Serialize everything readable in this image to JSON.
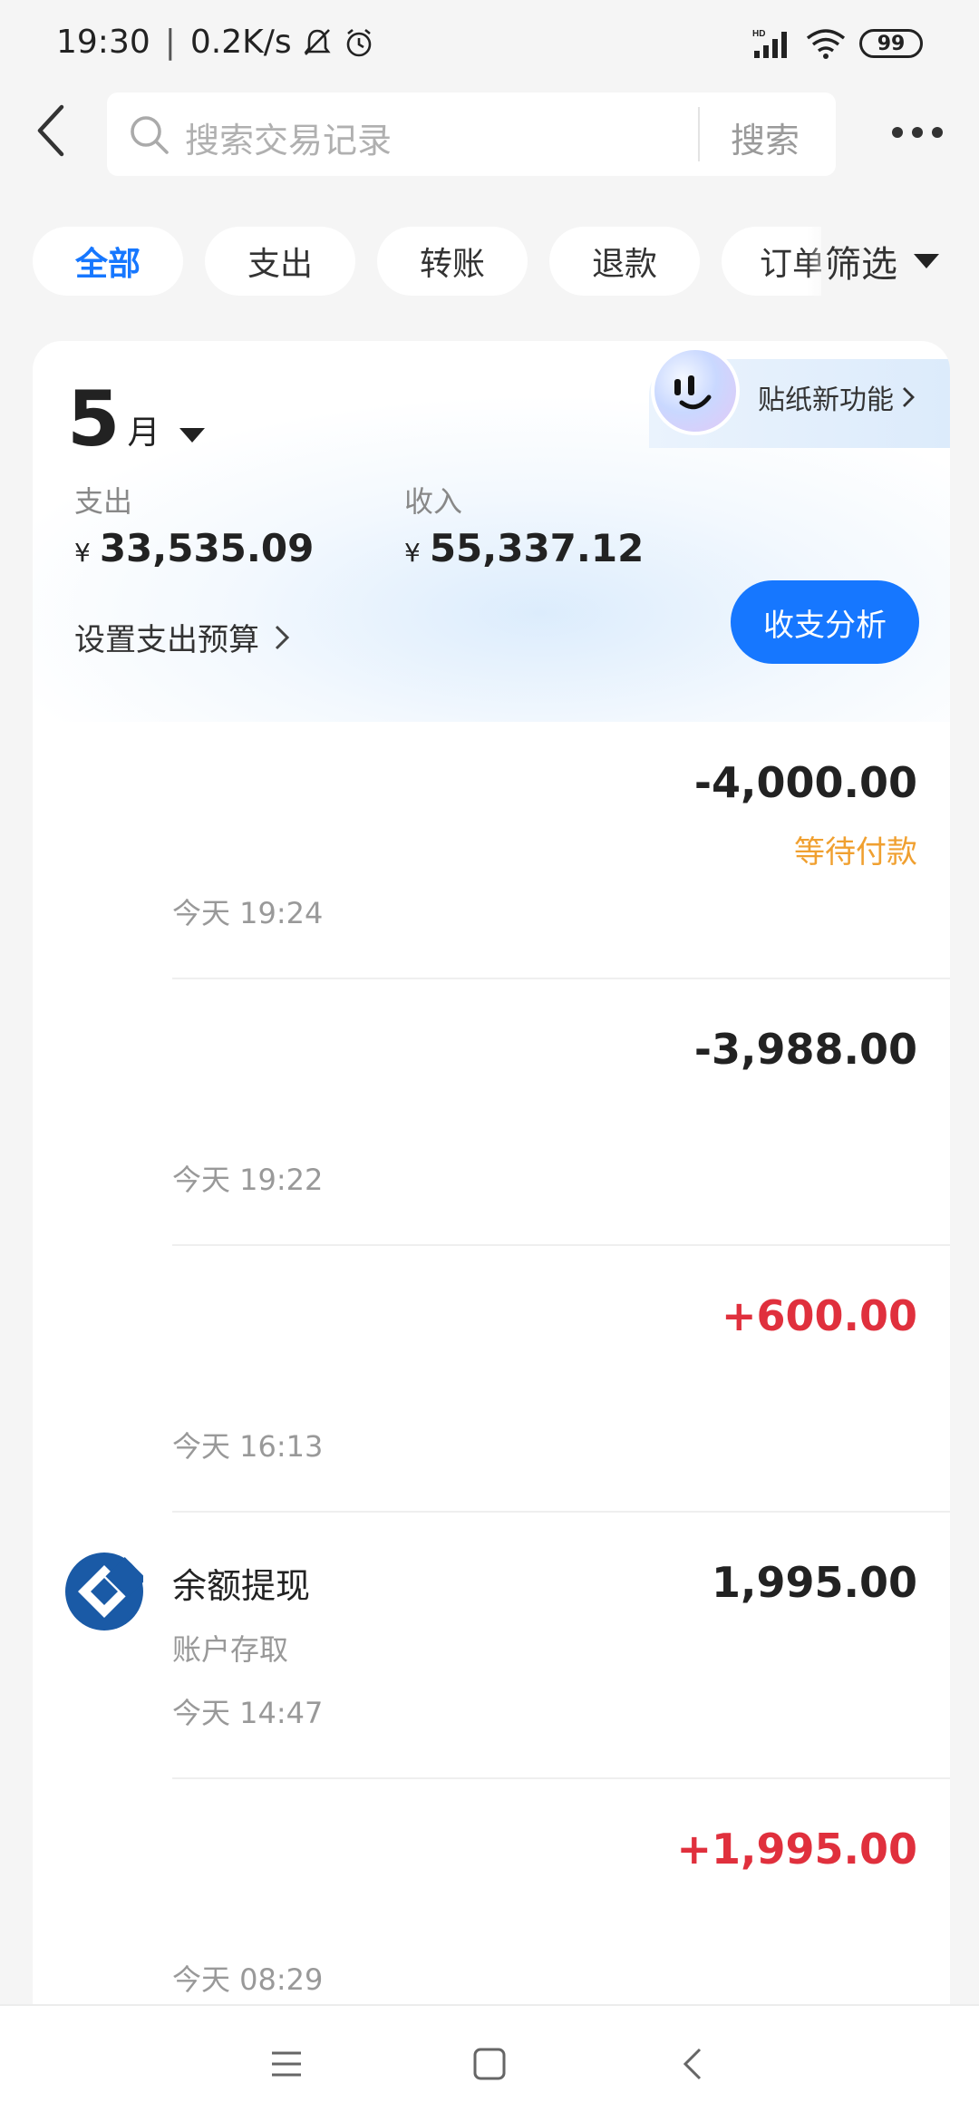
{
  "status_bar": {
    "time": "19:30",
    "net_speed": "0.2K/s",
    "signal_label": "HD",
    "battery": "99"
  },
  "search": {
    "placeholder": "搜索交易记录",
    "button_label": "搜索"
  },
  "tabs": [
    {
      "label": "全部",
      "active": true
    },
    {
      "label": "支出",
      "active": false
    },
    {
      "label": "转账",
      "active": false
    },
    {
      "label": "退款",
      "active": false
    },
    {
      "label": "订单",
      "active": false
    }
  ],
  "filter_label": "筛选",
  "summary": {
    "month_number": "5",
    "month_unit": "月",
    "expense_label": "支出",
    "expense_value": "33,535.09",
    "income_label": "收入",
    "income_value": "55,337.12",
    "currency_symbol": "¥",
    "budget_label": "设置支出预算",
    "analysis_button": "收支分析",
    "sticker_promo": "贴纸新功能"
  },
  "transactions": [
    {
      "title": "",
      "subtitle": "",
      "amount": "-4,000.00",
      "status": "等待付款",
      "time": "今天 19:24",
      "type": "expense"
    },
    {
      "title": "",
      "subtitle": "",
      "amount": "-3,988.00",
      "status": "",
      "time": "今天 19:22",
      "type": "expense"
    },
    {
      "title": "",
      "subtitle": "",
      "amount": "+600.00",
      "status": "",
      "time": "今天 16:13",
      "type": "income"
    },
    {
      "title": "余额提现",
      "subtitle": "账户存取",
      "amount": "1,995.00",
      "status": "",
      "time": "今天 14:47",
      "type": "neutral",
      "logo": "bank-logo-icon"
    },
    {
      "title": "",
      "subtitle": "",
      "amount": "+1,995.00",
      "status": "",
      "time": "今天 08:29",
      "type": "income"
    }
  ],
  "colors": {
    "accent": "#1677ff",
    "income": "#e0303d",
    "pending": "#f0a030",
    "background": "#f5f5f5"
  },
  "icons": [
    "back-arrow-icon",
    "search-icon",
    "more-dots-icon",
    "dropdown-triangle-icon",
    "chevron-right-icon",
    "bank-logo-icon",
    "menu-icon",
    "home-square-icon",
    "nav-back-icon"
  ]
}
